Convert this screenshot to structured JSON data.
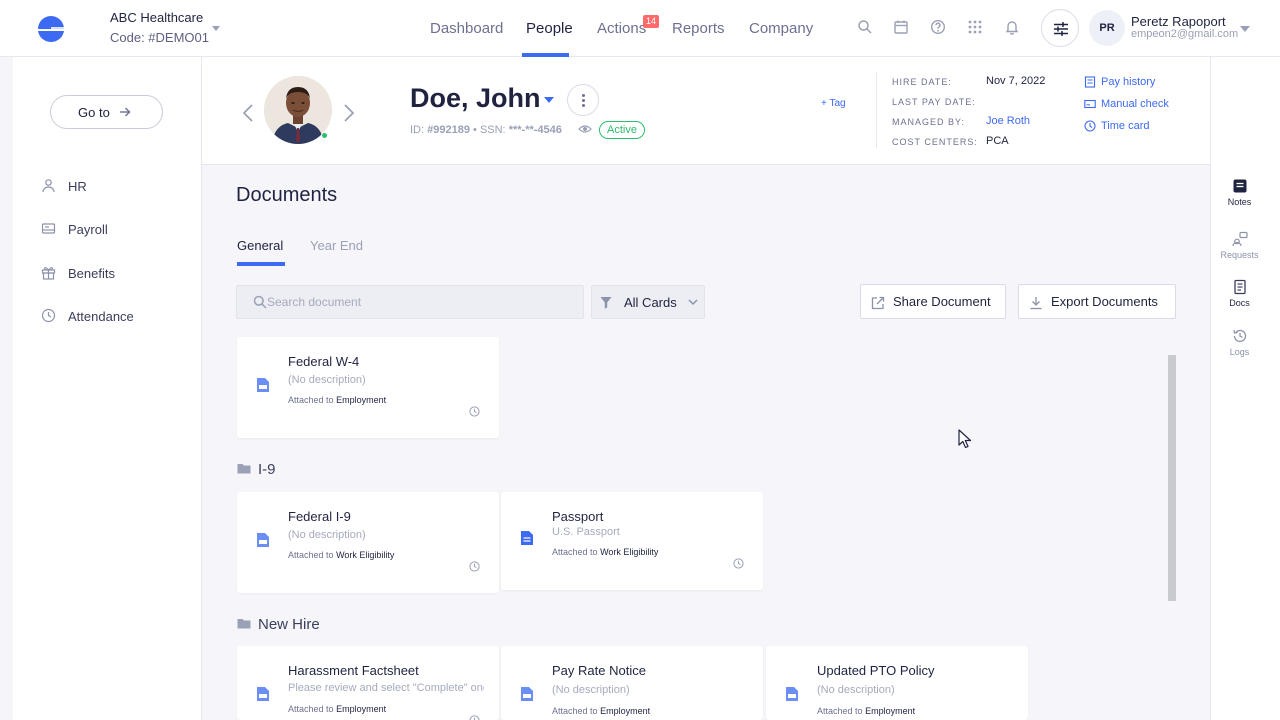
{
  "colors": {
    "accent": "#3d6af2",
    "success": "#2dbd6e",
    "badge": "#ff6b6b"
  },
  "company": {
    "name": "ABC Healthcare",
    "code": "Code: #DEMO01"
  },
  "nav": {
    "dashboard": "Dashboard",
    "people": "People",
    "actions": "Actions",
    "actions_badge": "14",
    "reports": "Reports",
    "company": "Company"
  },
  "topbar_icons": [
    "search-icon",
    "calendar-icon",
    "help-icon",
    "apps-icon",
    "bell-icon",
    "sliders-icon"
  ],
  "user": {
    "initials": "PR",
    "name": "Peretz Rapoport",
    "email": "empeon2@gmail.com"
  },
  "sidebar": {
    "goto": "Go to",
    "items": [
      {
        "label": "HR",
        "icon": "people-icon"
      },
      {
        "label": "Payroll",
        "icon": "payroll-icon"
      },
      {
        "label": "Benefits",
        "icon": "gift-icon"
      },
      {
        "label": "Attendance",
        "icon": "clock-icon"
      }
    ]
  },
  "rightrail": {
    "items": [
      {
        "label": "Notes",
        "icon": "notes-icon"
      },
      {
        "label": "Requests",
        "icon": "requests-icon"
      },
      {
        "label": "Docs",
        "icon": "docs-icon"
      },
      {
        "label": "Logs",
        "icon": "history-icon"
      }
    ]
  },
  "employee": {
    "name": "Doe, John",
    "id_label": "ID:",
    "id": "#992189",
    "ssn_label": "SSN:",
    "ssn": "***-**-4546",
    "status": "Active",
    "tag": "+ Tag",
    "details": {
      "hire_date_label": "HIRE DATE:",
      "hire_date": "Nov 7, 2022",
      "last_pay_label": "LAST PAY DATE:",
      "managed_by_label": "MANAGED BY:",
      "managed_by": "Joe Roth",
      "cost_centers_label": "COST CENTERS:",
      "cost_centers": "PCA"
    },
    "links": {
      "pay_history": "Pay history",
      "manual_check": "Manual check",
      "time_card": "Time card"
    }
  },
  "documents": {
    "title": "Documents",
    "tabs": [
      "General",
      "Year End"
    ],
    "search_placeholder": "Search document",
    "filter": "All Cards",
    "share": "Share Document",
    "export": "Export Documents",
    "attached_prefix": "Attached to",
    "groups": [
      {
        "name": "",
        "cards": [
          {
            "title": "Federal W-4",
            "desc": "(No description)",
            "attached": "Employment",
            "icon": "pdf-icon"
          }
        ]
      },
      {
        "name": "I-9",
        "cards": [
          {
            "title": "Federal I-9",
            "desc": "(No description)",
            "attached": "Work Eligibility",
            "icon": "pdf-icon"
          },
          {
            "title": "Passport",
            "desc": "U.S. Passport",
            "attached": "Work Eligibility",
            "icon": "document-icon"
          }
        ]
      },
      {
        "name": "New Hire",
        "cards": [
          {
            "title": "Harassment Factsheet",
            "desc": "Please review and select \"Complete\" once",
            "attached": "Employment",
            "icon": "pdf-icon"
          },
          {
            "title": "Pay Rate Notice",
            "desc": "(No description)",
            "attached": "Employment",
            "icon": "pdf-icon"
          },
          {
            "title": "Updated PTO Policy",
            "desc": "(No description)",
            "attached": "Employment",
            "icon": "pdf-icon"
          }
        ]
      }
    ]
  }
}
